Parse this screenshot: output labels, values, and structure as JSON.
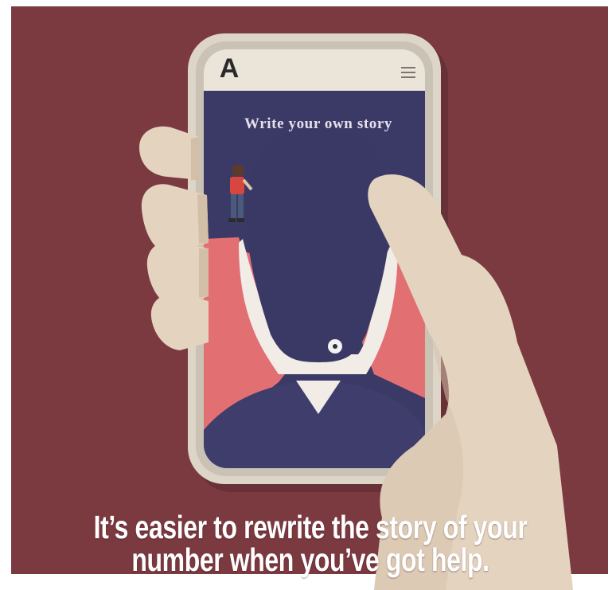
{
  "caption": {
    "line1": "It’s easier to rewrite the story of your",
    "line2": "number when you’ve got help."
  },
  "phone_screen": {
    "logo_letter": "A",
    "title": "Write your own story",
    "menu_icon": "hamburger-menu-icon"
  },
  "colors": {
    "background": "#7b3940",
    "screen_navy": "#3b3a67",
    "coral": "#e26f72",
    "hand": "#e4d3bf",
    "phone_body": "#dcd5c8"
  }
}
